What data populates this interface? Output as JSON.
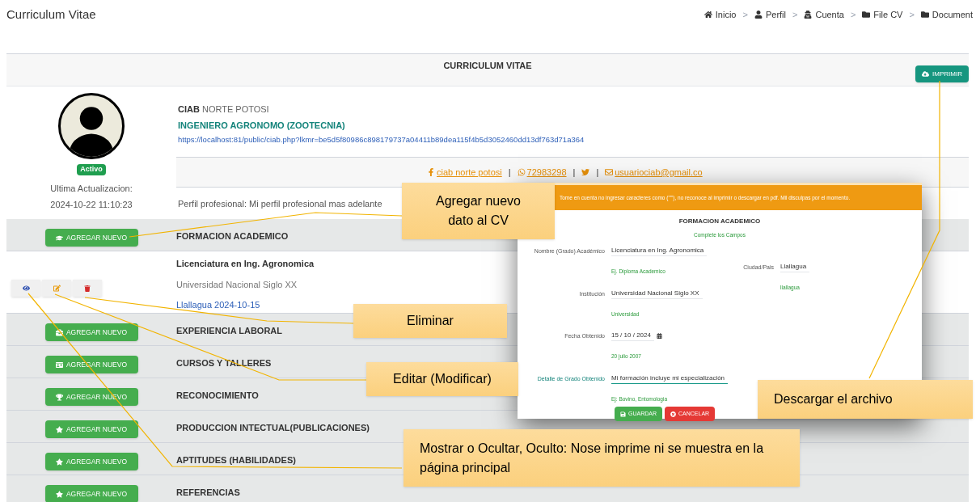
{
  "page_title": "Curriculum Vitae",
  "breadcrumb": [
    {
      "kind": "home",
      "label": "Inicio"
    },
    {
      "kind": "user",
      "separator": ">",
      "label": "Perfil"
    },
    {
      "kind": "account",
      "separator": ">",
      "label": "Cuenta"
    },
    {
      "kind": "folder",
      "separator": ">",
      "label": "File CV"
    },
    {
      "kind": "folder",
      "separator": ">",
      "label": "Document"
    }
  ],
  "panel": {
    "title": "CURRICULUM VITAE",
    "print_button": "IMPRIMIR"
  },
  "profile": {
    "status": "Activo",
    "updated_label": "Ultima Actualizacion:",
    "updated": "2024-10-22 11:10:23",
    "name_bold": "CIAB",
    "name_rest": "NORTE POTOSI",
    "profession": "INGENIERO AGRONOMO (ZOOTECNIA)",
    "url": "https://localhost:81/public/ciab.php?lkmr=be5d5f80986c898179737a04411b89dea115f4b5d3052460dd13df763d71a364",
    "contacts": [
      {
        "kind": "facebook",
        "label": "ciab norte potosi"
      },
      {
        "kind": "whatsapp",
        "separator": "|",
        "label": "72983298"
      },
      {
        "kind": "twitter",
        "separator": "|"
      },
      {
        "kind": "email",
        "separator": "|",
        "label": "usuariociab@gmail.co"
      }
    ],
    "summary": "Perfil profesional: Mi perfil profesional mas adelante"
  },
  "sections": [
    {
      "kind": "graduation",
      "button": "AGREGAR NUEVO",
      "title": "FORMACION ACADEMICO",
      "entries": [
        {
          "title": "Licenciatura en Ing. Agronomica",
          "institution": "Universidad Nacional Siglo XX",
          "place_date": "Llallagua 2024-10-15"
        }
      ]
    },
    {
      "kind": "briefcase",
      "button": "AGREGAR NUEVO",
      "title": "EXPERIENCIA LABORAL"
    },
    {
      "kind": "idcard",
      "button": "AGREGAR NUEVO",
      "title": "CURSOS Y TALLERES"
    },
    {
      "kind": "trophy",
      "button": "AGREGAR NUEVO",
      "title": "RECONOCIMIENTO"
    },
    {
      "kind": "star",
      "button": "AGREGAR NUEVO",
      "title": "PRODUCCION INTECTUAL(PUBLICACIONES)"
    },
    {
      "kind": "star",
      "button": "AGREGAR NUEVO",
      "title": "APTITUDES (HABILIDADES)"
    },
    {
      "kind": "star",
      "button": "AGREGAR NUEVO",
      "title": "REFERENCIAS"
    }
  ],
  "form_popup": {
    "notice": "Tome en cuenta no ingresar caracteres como (\"'\"), no reconoce al imprimir o descargar en pdf. Mil disculpas por el momento.",
    "title": "FORMACION ACADEMICO",
    "subtitle": "Complete los Campos",
    "fields": [
      {
        "label": "Nombre (Grado) Académico",
        "value": "Licenciatura en Ing. Agronomica",
        "hint": "Ej. Diploma Academico"
      },
      {
        "label": "Ciudad/Pais",
        "value": "Llallagua",
        "hint": "llallagua"
      },
      {
        "label": "Institución",
        "value": "Universidad Nacional Siglo XX",
        "hint": "Universidad"
      },
      {
        "label": "Fecha Obtenido",
        "value": "15 / 10 / 2024",
        "hint": "20 julio 2007"
      },
      {
        "label": "Detalle de Grado Obtenido",
        "value": "Mi formación incluye mi especialización",
        "hint": "Ej: Bovino, Entomologia"
      }
    ],
    "save_button": "GUARDAR",
    "cancel_button": "CANCELAR"
  },
  "callouts": [
    "Agregar nuevo dato al CV",
    "Eliminar",
    "Editar (Modificar)",
    "Descargar el archivo",
    "Mostrar o  Ocultar, Oculto: Nose imprime ni se  muestra en la página principal"
  ]
}
